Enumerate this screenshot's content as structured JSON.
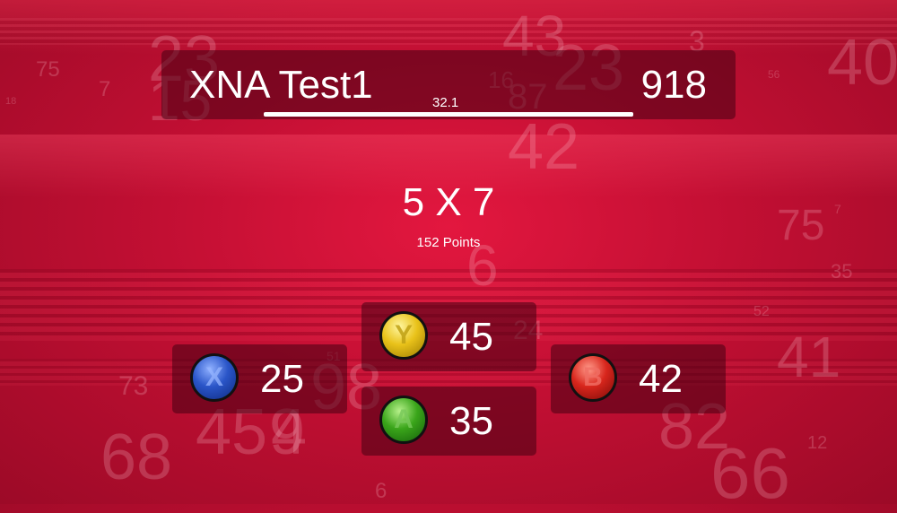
{
  "game": {
    "title": "XNA Test1",
    "score": "918",
    "timer": "32.1",
    "timer_progress": 1.0
  },
  "question": {
    "text": "5 X 7",
    "points": "152 Points"
  },
  "answers": {
    "x": {
      "button": "X",
      "value": "25",
      "color": "#2a55c8"
    },
    "y": {
      "button": "Y",
      "value": "45",
      "color": "#e9c21a"
    },
    "a": {
      "button": "A",
      "value": "35",
      "color": "#3aa51a"
    },
    "b": {
      "button": "B",
      "value": "42",
      "color": "#d8261c"
    }
  },
  "background_numbers": [
    "75",
    "7",
    "18",
    "23",
    "15",
    "43",
    "23",
    "16",
    "87",
    "3",
    "40",
    "56",
    "42",
    "75",
    "7",
    "35",
    "6",
    "52",
    "24",
    "51",
    "41",
    "73",
    "68",
    "45",
    "98",
    "4",
    "9",
    "82",
    "12",
    "66",
    "6"
  ]
}
